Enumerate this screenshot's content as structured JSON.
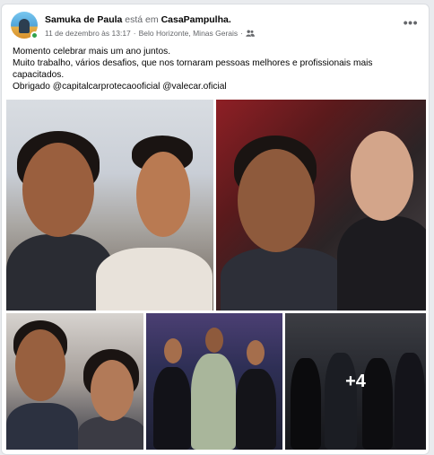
{
  "post": {
    "author": "Samuka de Paula",
    "connector": "está em",
    "place": "CasaPampulha.",
    "date": "11 de dezembro às 13:17",
    "separator": "·",
    "location": "Belo Horizonte, Minas Gerais",
    "separator2": "·",
    "more": "•••",
    "text_lines": [
      "Momento celebrar mais um ano juntos.",
      "Muito trabalho, vários desafios, que nos tornaram pessoas melhores e profissionais mais",
      "capacitados.",
      "Obrigado @capitalcarprotecaooficial @valecar.oficial"
    ]
  },
  "gallery": {
    "more_count": "+4"
  },
  "icons": {
    "avatar": "profile-photo",
    "audience": "friends-icon",
    "more": "more-options-icon"
  }
}
